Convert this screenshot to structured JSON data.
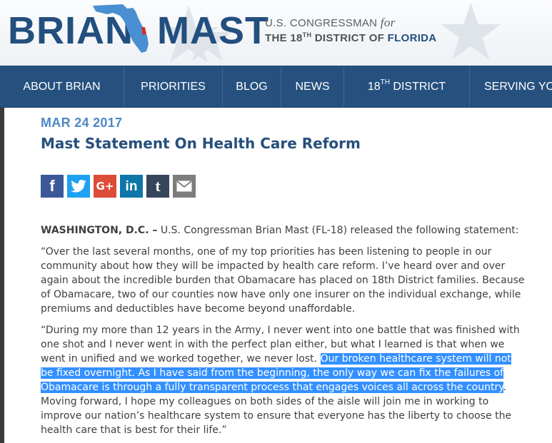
{
  "header": {
    "name_first": "BRIAN",
    "name_last": "MAST",
    "tagline_prefix": "U.S. CONGRESSMAN",
    "tagline_for": "for",
    "tagline_the": "THE 18",
    "tagline_th": "TH",
    "tagline_district": " DISTRICT OF ",
    "tagline_state": "FLORIDA"
  },
  "nav": {
    "items": [
      {
        "label": "ABOUT BRIAN"
      },
      {
        "label": "PRIORITIES"
      },
      {
        "label": "BLOG"
      },
      {
        "label": "NEWS"
      },
      {
        "label_pre": "18",
        "label_sup": "TH",
        "label_post": " DISTRICT"
      },
      {
        "label": "SERVING YOU"
      }
    ]
  },
  "article": {
    "date": "MAR 24 2017",
    "title": "Mast Statement On Health Care Reform",
    "share_icons": [
      "facebook-icon",
      "twitter-icon",
      "google-plus-icon",
      "linkedin-icon",
      "tumblr-icon",
      "email-icon"
    ],
    "dateline": "WASHINGTON, D.C. –",
    "intro": " U.S. Congressman Brian Mast (FL-18) released the following statement:",
    "para1": "“Over the last several months, one of my top priorities has been listening to people in our community about how they will be impacted by health care reform. I’ve heard over and over again about the incredible burden that Obamacare has placed on 18th District families. Because of Obamacare, two of our counties now have only one insurer on the individual exchange, while premiums and deductibles have become beyond unaffordable.",
    "para2_before": "“During my more than 12 years in the Army, I never went into one battle that was finished with one shot and I never went in with the perfect plan either, but what I learned is that when we went in unified and we worked together, we never lost. ",
    "para2_highlight": "Our broken healthcare system will not be fixed overnight. As I have said from the beginning, the only way we can fix the failures of Obamacare is through a fully transparent process that engages voices all across the country",
    "para2_after": ". Moving forward, I hope my colleagues on both sides of the aisle will join me in working to improve our nation’s healthcare system to ensure that everyone has the liberty to choose the health care that is best for their life.”",
    "end_mark": "###"
  },
  "colors": {
    "brand_blue": "#224f7e",
    "nav_bg": "#26517f",
    "date_blue": "#4d88c7",
    "selection": "#3390ff"
  }
}
